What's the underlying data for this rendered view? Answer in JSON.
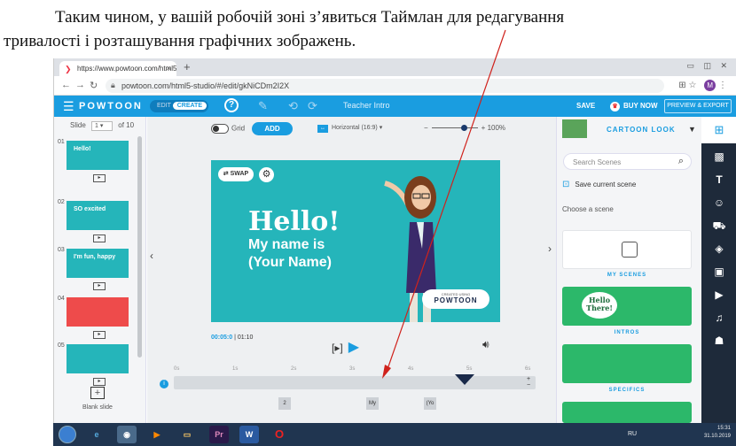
{
  "document": {
    "line1": "Таким чином, у вашій робочій зоні з’явиться Таймлан для редагування",
    "line2": "тривалості і розташування графічних зображень."
  },
  "browser": {
    "tab_title": "https://www.powtoon.com/html5-",
    "tab_close": "×",
    "new_tab": "+",
    "url": "powtoon.com/html5-studio/#/edit/gkNiCDm2I2X",
    "profile_initial": "M",
    "window_controls": "▭ ◫ ✕"
  },
  "toolbar": {
    "logo": "POWTOON",
    "mode_edit": "EDIT",
    "mode_create": "CREATE",
    "help": "?",
    "presentation_title": "Teacher Intro",
    "save": "SAVE",
    "buy_now": "BUY NOW",
    "preview_export": "PREVIEW & EXPORT"
  },
  "slides_panel": {
    "label": "Slide",
    "current": "1",
    "of": "of 10",
    "numbers": [
      "01",
      "02",
      "03",
      "04",
      "05"
    ],
    "thumbs": [
      {
        "color": "#25b5ba",
        "text": "Hello!"
      },
      {
        "color": "#25b5ba",
        "text": "SO excited"
      },
      {
        "color": "#25b5ba",
        "text": "I'm fun, happy"
      },
      {
        "color": "#ee4b4b",
        "text": ""
      },
      {
        "color": "#25b5ba",
        "text": ""
      }
    ],
    "blank_slide": "Blank slide"
  },
  "canvas": {
    "grid_label": "Grid",
    "add_button": "ADD",
    "orientation": "Horizontal (16:9)",
    "zoom_percent": "100%",
    "zoom_level": 0.7,
    "swap_label": "SWAP",
    "hello": "Hello!",
    "name_line1": "My name is",
    "name_line2": "(Your Name)",
    "badge_small": "CREATED USING",
    "badge_big": "POWTOON",
    "current_time": "00:05:0",
    "total_time": "01:10"
  },
  "timeline": {
    "ticks": [
      "0s",
      "1s",
      "2s",
      "3s",
      "4s",
      "5s",
      "6s"
    ],
    "chips": [
      "2",
      "My",
      "(Yo"
    ],
    "zoom_in": "+",
    "zoom_out": "−"
  },
  "scenes_panel": {
    "look": "CARTOON LOOK",
    "search_placeholder": "Search Scenes",
    "save_current": "Save current scene",
    "choose": "Choose a scene",
    "my_scenes": "MY SCENES",
    "intros": "INTROS",
    "specifics": "SPECIFICS",
    "hello_there": "Hello There!"
  },
  "taskbar": {
    "lang": "RU",
    "time": "15:31",
    "date": "31.10.2019"
  },
  "colors": {
    "accent": "#1a9de0",
    "stage": "#25b5ba",
    "annotation": "#d0221c"
  }
}
